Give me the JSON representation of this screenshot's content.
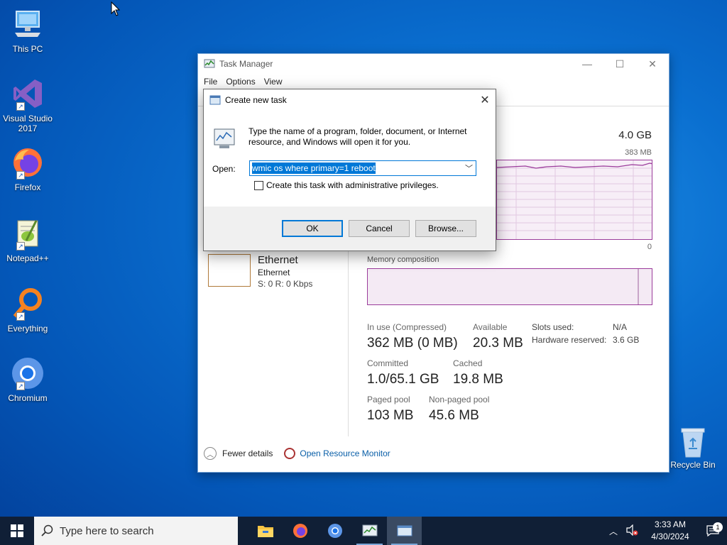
{
  "desktop": {
    "icons": [
      {
        "label": "This PC",
        "icon": "this-pc-icon"
      },
      {
        "label": "Visual Studio 2017",
        "icon": "visual-studio-icon"
      },
      {
        "label": "Firefox",
        "icon": "firefox-icon"
      },
      {
        "label": "Notepad++",
        "icon": "notepad-plus-plus-icon"
      },
      {
        "label": "Everything",
        "icon": "everything-icon"
      },
      {
        "label": "Chromium",
        "icon": "chromium-icon"
      }
    ],
    "recycle_bin": "Recycle Bin"
  },
  "task_manager": {
    "title": "Task Manager",
    "menu": [
      "File",
      "Options",
      "View"
    ],
    "memory_total": "4.0 GB",
    "memory_max": "383 MB",
    "graph_min": "0",
    "composition_label": "Memory composition",
    "ethernet": {
      "name": "Ethernet",
      "sub": "Ethernet",
      "rate": "S: 0 R: 0 Kbps"
    },
    "stats": {
      "in_use_label": "In use (Compressed)",
      "in_use_value": "362 MB (0 MB)",
      "available_label": "Available",
      "available_value": "20.3 MB",
      "committed_label": "Committed",
      "committed_value": "1.0/65.1 GB",
      "cached_label": "Cached",
      "cached_value": "19.8 MB",
      "paged_label": "Paged pool",
      "paged_value": "103 MB",
      "nonpaged_label": "Non-paged pool",
      "nonpaged_value": "45.6 MB",
      "slots_label": "Slots used:",
      "slots_value": "N/A",
      "hw_reserved_label": "Hardware reserved:",
      "hw_reserved_value": "3.6 GB"
    },
    "footer": {
      "fewer_details": "Fewer details",
      "open_resource_monitor": "Open Resource Monitor"
    }
  },
  "dialog": {
    "title": "Create new task",
    "description": "Type the name of a program, folder, document, or Internet resource, and Windows will open it for you.",
    "open_label": "Open:",
    "open_value": "wmic os where primary=1 reboot",
    "admin_checkbox": "Create this task with administrative privileges.",
    "admin_checked": false,
    "ok": "OK",
    "cancel": "Cancel",
    "browse": "Browse..."
  },
  "taskbar": {
    "search_placeholder": "Type here to search",
    "apps": [
      "file-explorer-icon",
      "firefox-icon",
      "chromium-icon",
      "task-manager-icon",
      "run-dialog-icon"
    ],
    "time": "3:33 AM",
    "date": "4/30/2024",
    "notification_count": "1"
  },
  "colors": {
    "accent": "#0078d7",
    "memory_purple": "#9b3c9b",
    "taskbar": "#101f36"
  }
}
